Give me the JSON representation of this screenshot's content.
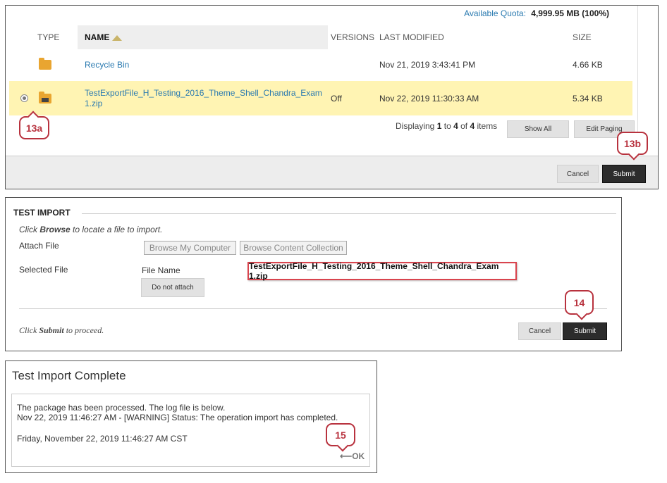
{
  "file_browser": {
    "quota_label": "Available Quota:",
    "quota_value": "4,999.95 MB (100%)",
    "columns": {
      "type": "TYPE",
      "name": "NAME",
      "versions": "VERSIONS",
      "last_modified": "LAST MODIFIED",
      "size": "SIZE"
    },
    "rows": [
      {
        "name": "Recycle Bin",
        "versions": "",
        "modified": "Nov 21, 2019 3:43:41 PM",
        "size": "4.66 KB"
      },
      {
        "name_line1": "TestExportFile_H_Testing_2016_Theme_Shell_Chandra_Exam",
        "name_line2": "1.zip",
        "versions": "Off",
        "modified": "Nov 22, 2019 11:30:33 AM",
        "size": "5.34 KB"
      }
    ],
    "paging": {
      "prefix": "Displaying",
      "from": "1",
      "to_word": "to",
      "to": "4",
      "of_word": "of",
      "total": "4",
      "suffix": "items"
    },
    "show_all": "Show All",
    "edit_paging": "Edit Paging",
    "cancel": "Cancel",
    "submit": "Submit"
  },
  "callouts": {
    "c13a": "13a",
    "c13b": "13b",
    "c14": "14",
    "c15": "15"
  },
  "test_import": {
    "section_title": "TEST IMPORT",
    "instr_prefix": "Click",
    "instr_bold": "Browse",
    "instr_suffix": "to locate a file to import.",
    "attach_label": "Attach File",
    "browse_computer": "Browse My Computer",
    "browse_collection": "Browse Content Collection",
    "selected_label": "Selected File",
    "file_name_label": "File Name",
    "file_name": "TestExportFile_H_Testing_2016_Theme_Shell_Chandra_Exam 1.zip",
    "do_not_attach": "Do not attach",
    "proceed_prefix": "Click",
    "proceed_bold": "Submit",
    "proceed_suffix": "to proceed.",
    "cancel": "Cancel",
    "submit": "Submit"
  },
  "complete": {
    "title": "Test Import Complete",
    "line1": "The package has been processed. The log file is below.",
    "line2": "Nov 22, 2019 11:46:27 AM - [WARNING] Status: The operation import has completed.",
    "line3": "Friday, November 22, 2019 11:46:27 AM CST",
    "ok": "OK",
    "ok_arrow": "⟵"
  }
}
